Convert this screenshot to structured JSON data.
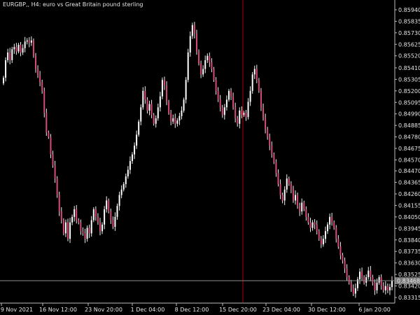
{
  "header": {
    "symbol_title": "EURGBP,, H4:  euro vs Great Britain pound sterling"
  },
  "colors": {
    "background": "#000000",
    "axis": "#bdbdbd",
    "candle_up": "#ffffff",
    "candle_down": "#d94a7a",
    "shadow": "#f0f0f0",
    "crosshair_v": "#b30000",
    "crosshair_h": "#8c8c8c",
    "current_price_bg": "#7a7a7a"
  },
  "chart_data": {
    "type": "candlestick",
    "title": "EURGBP,, H4:  euro vs Great Britain pound sterling",
    "y_axis": {
      "ticks": [
        "0.85940",
        "0.85835",
        "0.85730",
        "0.85625",
        "0.85520",
        "0.85410",
        "0.85305",
        "0.85200",
        "0.85095",
        "0.84990",
        "0.84885",
        "0.84780",
        "0.84675",
        "0.84570",
        "0.84470",
        "0.84365",
        "0.84260",
        "0.84155",
        "0.84050",
        "0.83945",
        "0.83840",
        "0.83735",
        "0.83630",
        "0.83525",
        "0.83420",
        "0.83315"
      ],
      "range": [
        0.8327,
        0.8601
      ]
    },
    "x_axis": {
      "ticks": [
        "9 Nov 2021",
        "16 Nov 12:00",
        "23 Nov 20:00",
        "1 Dec 04:00",
        "8 Dec 12:00",
        "15 Dec 20:00",
        "23 Dec 04:00",
        "30 Dec 12:00",
        "6 Jan 20:00"
      ]
    },
    "current_price": "0.83468",
    "candles_close": [
      0.8532,
      0.8548,
      0.8555,
      0.8548,
      0.8558,
      0.856,
      0.8556,
      0.8562,
      0.8555,
      0.8559,
      0.8565,
      0.8566,
      0.8564,
      0.8566,
      0.8552,
      0.854,
      0.8534,
      0.8528,
      0.852,
      0.85,
      0.8482,
      0.8478,
      0.8462,
      0.8452,
      0.844,
      0.8425,
      0.841,
      0.8402,
      0.839,
      0.84,
      0.8385,
      0.84,
      0.8405,
      0.8412,
      0.8402,
      0.84,
      0.8392,
      0.839,
      0.8385,
      0.8395,
      0.839,
      0.8402,
      0.8412,
      0.8405,
      0.84,
      0.8392,
      0.8398,
      0.8412,
      0.842,
      0.841,
      0.8402,
      0.8396,
      0.8405,
      0.8415,
      0.8425,
      0.843,
      0.8435,
      0.8442,
      0.8448,
      0.8456,
      0.8462,
      0.847,
      0.848,
      0.8492,
      0.8505,
      0.852,
      0.8512,
      0.8502,
      0.8508,
      0.8498,
      0.849,
      0.8495,
      0.8505,
      0.8515,
      0.853,
      0.8525,
      0.851,
      0.85,
      0.8492,
      0.8495,
      0.849,
      0.8493,
      0.8497,
      0.8502,
      0.8512,
      0.853,
      0.8555,
      0.857,
      0.858,
      0.8572,
      0.8556,
      0.8545,
      0.8535,
      0.854,
      0.8548,
      0.8552,
      0.8546,
      0.854,
      0.853,
      0.852,
      0.8512,
      0.8505,
      0.8498,
      0.8505,
      0.8512,
      0.852,
      0.8515,
      0.8505,
      0.8495,
      0.849,
      0.8502,
      0.8498,
      0.85,
      0.8496,
      0.851,
      0.852,
      0.8535,
      0.854,
      0.853,
      0.852,
      0.8505,
      0.8495,
      0.8485,
      0.8478,
      0.847,
      0.8462,
      0.8455,
      0.8445,
      0.8435,
      0.8425,
      0.842,
      0.843,
      0.844,
      0.8435,
      0.843,
      0.842,
      0.8425,
      0.8415,
      0.841,
      0.8418,
      0.8412,
      0.8405,
      0.84,
      0.8395,
      0.84,
      0.8398,
      0.8392,
      0.8385,
      0.838,
      0.8385,
      0.8392,
      0.8398,
      0.8405,
      0.84,
      0.8395,
      0.8385,
      0.8378,
      0.837,
      0.8365,
      0.8358,
      0.835,
      0.8345,
      0.834,
      0.8335,
      0.834,
      0.8348,
      0.8355,
      0.835,
      0.8345,
      0.835,
      0.8356,
      0.835,
      0.8345,
      0.8338,
      0.8345,
      0.835,
      0.8342,
      0.8338,
      0.8342,
      0.8338,
      0.8341,
      0.8347
    ]
  }
}
